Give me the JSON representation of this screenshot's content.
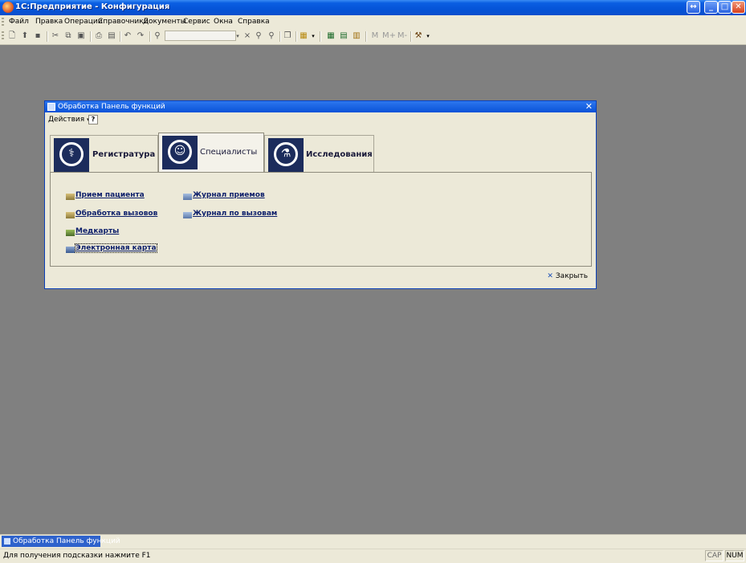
{
  "app": {
    "title": "1С:Предприятие - Конфигурация",
    "window_buttons": {
      "restore_extra": "↔",
      "minimize": "_",
      "maximize": "□",
      "close": "✕"
    }
  },
  "menu": {
    "items": [
      "Файл",
      "Правка",
      "Операции",
      "Справочники",
      "Документы",
      "Сервис",
      "Окна",
      "Справка"
    ]
  },
  "toolbar": {
    "icons": [
      "new-document-icon",
      "open-icon",
      "save-icon",
      "cut-icon",
      "copy-icon",
      "paste-icon",
      "print-icon",
      "preview-icon",
      "undo-icon",
      "redo-icon",
      "find-icon",
      "search-combo",
      "clear-search-icon",
      "find-next-icon",
      "find-prev-icon",
      "window-icon",
      "reports-icon",
      "table-icon",
      "calendar-icon",
      "calc-icon",
      "m-icon",
      "m-plus-icon",
      "m-minus-icon",
      "tools-icon"
    ],
    "m_labels": [
      "M",
      "M+",
      "M-"
    ],
    "search_value": ""
  },
  "child_window": {
    "title": "Обработка  Панель функций",
    "actions_label": "Действия",
    "help_label": "?",
    "tabs": [
      {
        "label": "Регистратура",
        "icon": "caduceus-icon",
        "active": false
      },
      {
        "label": "Специалисты",
        "icon": "doctor-face-icon",
        "active": true
      },
      {
        "label": "Исследования",
        "icon": "flasks-icon",
        "active": false
      }
    ],
    "links_left": [
      "Прием пациента",
      "Обработка вызовов",
      "Медкарты",
      "Электронная карта"
    ],
    "links_right": [
      "Журнал приемов",
      "Журнал по вызовам"
    ],
    "close_label": "Закрыть"
  },
  "taskbar": {
    "open_window": "Обработка  Панель функций"
  },
  "statusbar": {
    "hint": "Для получения подсказки нажмите F1",
    "indicators": [
      "CAP",
      "NUM"
    ],
    "indicator_on": [
      false,
      true
    ]
  }
}
